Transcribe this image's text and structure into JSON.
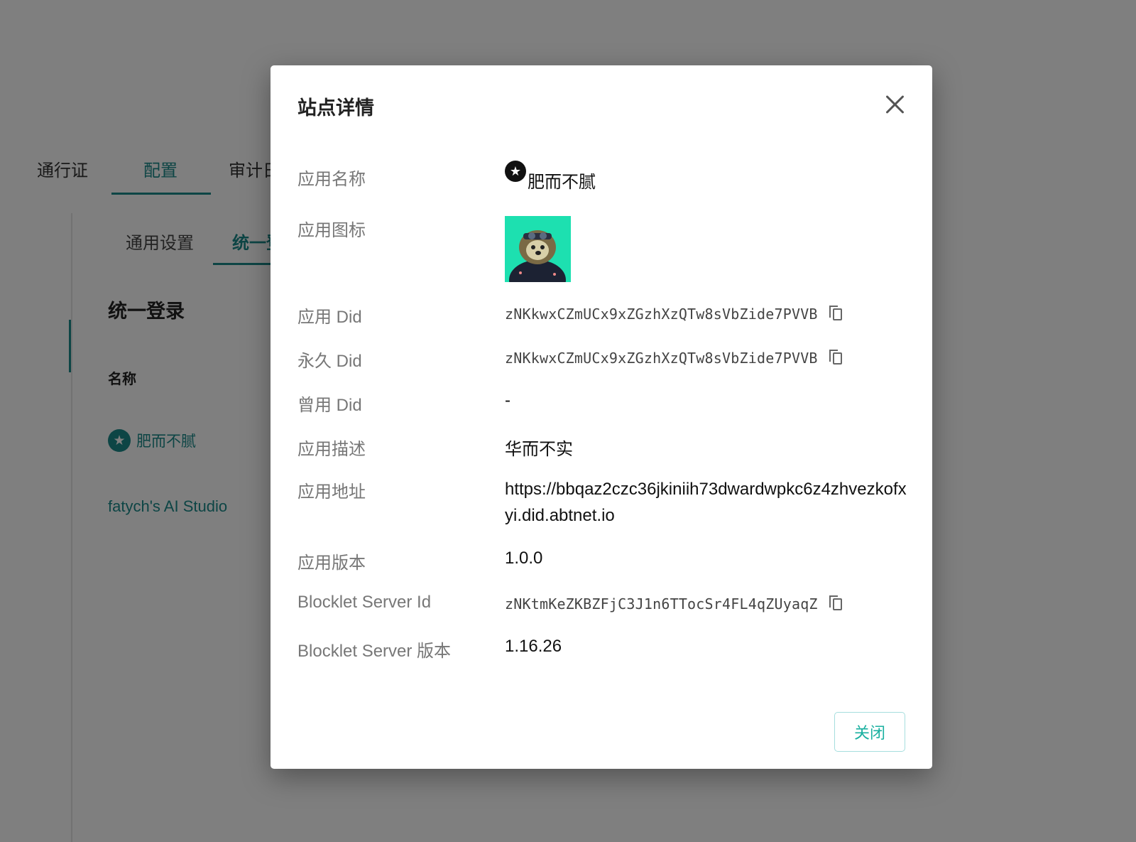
{
  "background": {
    "tabs": [
      "通行证",
      "配置",
      "审计日志"
    ],
    "active_tab": "配置",
    "subtabs": [
      "通用设置",
      "统一登录"
    ],
    "active_subtab": "统一登录",
    "section_title": "统一登录",
    "name_label": "名称",
    "app_name": "肥而不腻",
    "studio": "fatych's AI Studio"
  },
  "modal": {
    "title": "站点详情",
    "rows": {
      "app_name": {
        "label": "应用名称",
        "value": "肥而不腻"
      },
      "app_icon": {
        "label": "应用图标"
      },
      "app_did": {
        "label": "应用 Did",
        "value": "zNKkwxCZmUCx9xZGzhXzQTw8sVbZide7PVVB"
      },
      "perm_did": {
        "label": "永久 Did",
        "value": "zNKkwxCZmUCx9xZGzhXzQTw8sVbZide7PVVB"
      },
      "old_did": {
        "label": "曾用 Did",
        "value": "-"
      },
      "desc": {
        "label": "应用描述",
        "value": "华而不实"
      },
      "url": {
        "label": "应用地址",
        "value": "https://bbqaz2czc36jkiniih73dwardwpkc6z4zhvezkofxyi.did.abtnet.io"
      },
      "version": {
        "label": "应用版本",
        "value": "1.0.0"
      },
      "server_id": {
        "label": "Blocklet Server Id",
        "value": "zNKtmKeZKBZFjC3J1n6TTocSr4FL4qZUyaqZ"
      },
      "server_version": {
        "label": "Blocklet Server 版本",
        "value": "1.16.26"
      }
    },
    "close_button": "关闭"
  },
  "colors": {
    "accent": "#1b8a8a",
    "link": "#1ab0a0",
    "icon_bg": "#1de0b0"
  }
}
